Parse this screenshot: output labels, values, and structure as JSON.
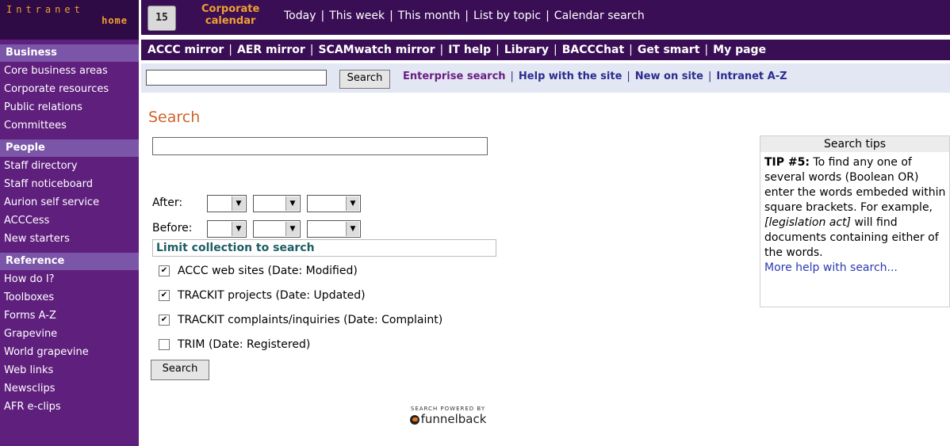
{
  "sidebar": {
    "logo": {
      "line1": "Intranet",
      "line2": "home"
    },
    "sections": [
      {
        "heading": "Business",
        "items": [
          "Core business areas",
          "Corporate resources",
          "Public relations",
          "Committees"
        ]
      },
      {
        "heading": "People",
        "items": [
          "Staff directory",
          "Staff noticeboard",
          "Aurion self service",
          "ACCCess",
          "New starters"
        ]
      },
      {
        "heading": "Reference",
        "items": [
          "How do I?",
          "Toolboxes",
          "Forms A-Z",
          "Grapevine",
          "World grapevine",
          "Web links",
          "Newsclips",
          "AFR e-clips"
        ]
      }
    ]
  },
  "topbar": {
    "calendar_icon_text": "15",
    "calendar_label_1": "Corporate",
    "calendar_label_2": "calendar",
    "calendar_links": [
      "Today",
      "This week",
      "This month",
      "List by topic",
      "Calendar search"
    ],
    "separator": "|",
    "mirror_links": [
      "ACCC mirror",
      "AER mirror",
      "SCAMwatch mirror",
      "IT help",
      "Library",
      "BACCChat",
      "Get smart",
      "My page"
    ]
  },
  "searchbar": {
    "input_value": "",
    "button_label": "Search",
    "links": [
      "Enterprise search",
      "Help with the site",
      "New on site",
      "Intranet A-Z"
    ]
  },
  "main": {
    "title": "Search",
    "query_value": "",
    "after_label": "After:",
    "before_label": "Before:",
    "limit_heading": "Limit collection to search",
    "collections": [
      {
        "label": "ACCC web sites (Date: Modified)",
        "checked": true
      },
      {
        "label": "TRACKIT projects (Date: Updated)",
        "checked": true
      },
      {
        "label": "TRACKIT complaints/inquiries (Date: Complaint)",
        "checked": true
      },
      {
        "label": "TRIM (Date: Registered)",
        "checked": false
      }
    ],
    "search_button": "Search",
    "powered_by": "SEARCH POWERED BY",
    "powered_brand": "funnelback"
  },
  "tips": {
    "heading": "Search tips",
    "tip_label": "TIP #5:",
    "tip_text_1": " To find any one of several words (Boolean OR) enter the words embeded within square brackets. For example, ",
    "tip_example": "[legislation act]",
    "tip_text_2": " will find documents containing either of the words.",
    "more_link": "More help with search..."
  },
  "colors": {
    "sidebar": "#5f1f7d",
    "topbar": "#3a0e55",
    "accent_orange": "#f0a030",
    "title_orange": "#d0632a",
    "searchbar_bg": "#e3e7f3"
  },
  "icons": [
    "calendar-icon",
    "dropdown-arrow-icon",
    "checkbox-icon",
    "funnelback-logo-icon"
  ]
}
